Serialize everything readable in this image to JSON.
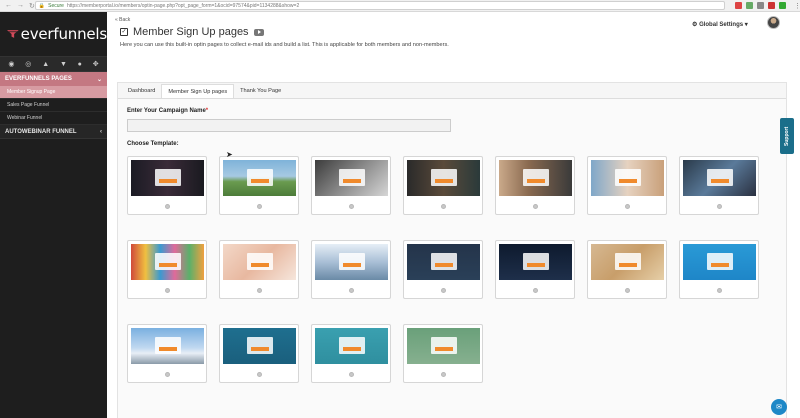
{
  "browser": {
    "secure_label": "Secure",
    "url": "https://memberportal.io/members/optin-page.php?opt_page_form=1&ocid=97574&pid=1134288&show=2"
  },
  "sidebar": {
    "logo_text": "everfunnels",
    "header": "EVERFUNNELS PAGES",
    "items": [
      {
        "label": "Member Signup Page"
      },
      {
        "label": "Sales Page Funnel"
      },
      {
        "label": "Webinar Funnel"
      }
    ],
    "section2": "AUTOWEBINAR FUNNEL"
  },
  "header": {
    "back_label": "« Back",
    "title": "Member Sign Up pages",
    "description": "Here you can use this built-in optin pages to collect e-mail ids and build a list. This is applicable for both members and non-members.",
    "global_settings": "Global Settings"
  },
  "tabs": [
    {
      "label": "Dashboard"
    },
    {
      "label": "Member Sign Up pages"
    },
    {
      "label": "Thank You Page"
    }
  ],
  "form": {
    "campaign_label": "Enter Your Campaign Name",
    "campaign_required": "*",
    "campaign_value": "",
    "choose_label": "Choose Template:"
  },
  "templates": [
    {
      "bg": "linear-gradient(90deg,#1b1b24 0%,#3a2b38 50%,#1a1a20 100%)"
    },
    {
      "bg": "linear-gradient(180deg,#7fb3d9 0%,#a6c9e2 45%,#6a9b4f 60%,#4d7c3a 100%)"
    },
    {
      "bg": "linear-gradient(135deg,#3c3c3c 0%,#8a8a8a 50%,#d6d6d6 100%)"
    },
    {
      "bg": "linear-gradient(90deg,#2a2a2a 0%,#5a4a3a 50%,#2a3a3a 100%)"
    },
    {
      "bg": "linear-gradient(90deg,#caa98a 0%,#8a6a50 40%,#3a3a3a 100%)"
    },
    {
      "bg": "linear-gradient(90deg,#7fa7c9 0%,#e6d2c0 50%,#c9a07a 100%)"
    },
    {
      "bg": "linear-gradient(135deg,#2a3a4a 0%,#5a7a9a 50%,#2a3040 100%)"
    },
    {
      "bg": "linear-gradient(90deg,#d04a3a 0%,#f0c040 20%,#3a9ad0 40%,#e06a9a 60%,#5ab06a 80%,#f0a040 100%)"
    },
    {
      "bg": "linear-gradient(135deg,#f3d8c8 0%,#e8b8a0 50%,#f6e6dc 100%)"
    },
    {
      "bg": "linear-gradient(180deg,#e6eef6 0%,#a9bfd6 50%,#6a8aa6 100%)"
    },
    {
      "bg": "linear-gradient(180deg,#24344a 0%,#2a4058 100%)"
    },
    {
      "bg": "linear-gradient(180deg,#0e1a2e 0%,#1e2f4a 100%)"
    },
    {
      "bg": "linear-gradient(135deg,#d6b892 0%,#c89e6a 50%,#e6cfa8 100%)"
    },
    {
      "bg": "linear-gradient(180deg,#2a9ad6 0%,#1e86c8 100%)"
    },
    {
      "bg": "linear-gradient(180deg,#7ab0e0 0%,#c0d8f0 55%,#e8eef6 70%,#8a9aa8 100%)"
    },
    {
      "bg": "linear-gradient(180deg,#1f6f8f 0%,#1a5f7d 100%)"
    },
    {
      "bg": "linear-gradient(180deg,#3aa0b0 0%,#2f8f9f 100%)"
    },
    {
      "bg": "linear-gradient(180deg,#6aa07a 0%,#86b08f 100%)"
    }
  ],
  "support_label": "Support",
  "colors": {
    "sidebar_bg": "#1e1e1e",
    "sidebar_accent": "#c47882",
    "cta": "#f08a2c"
  }
}
